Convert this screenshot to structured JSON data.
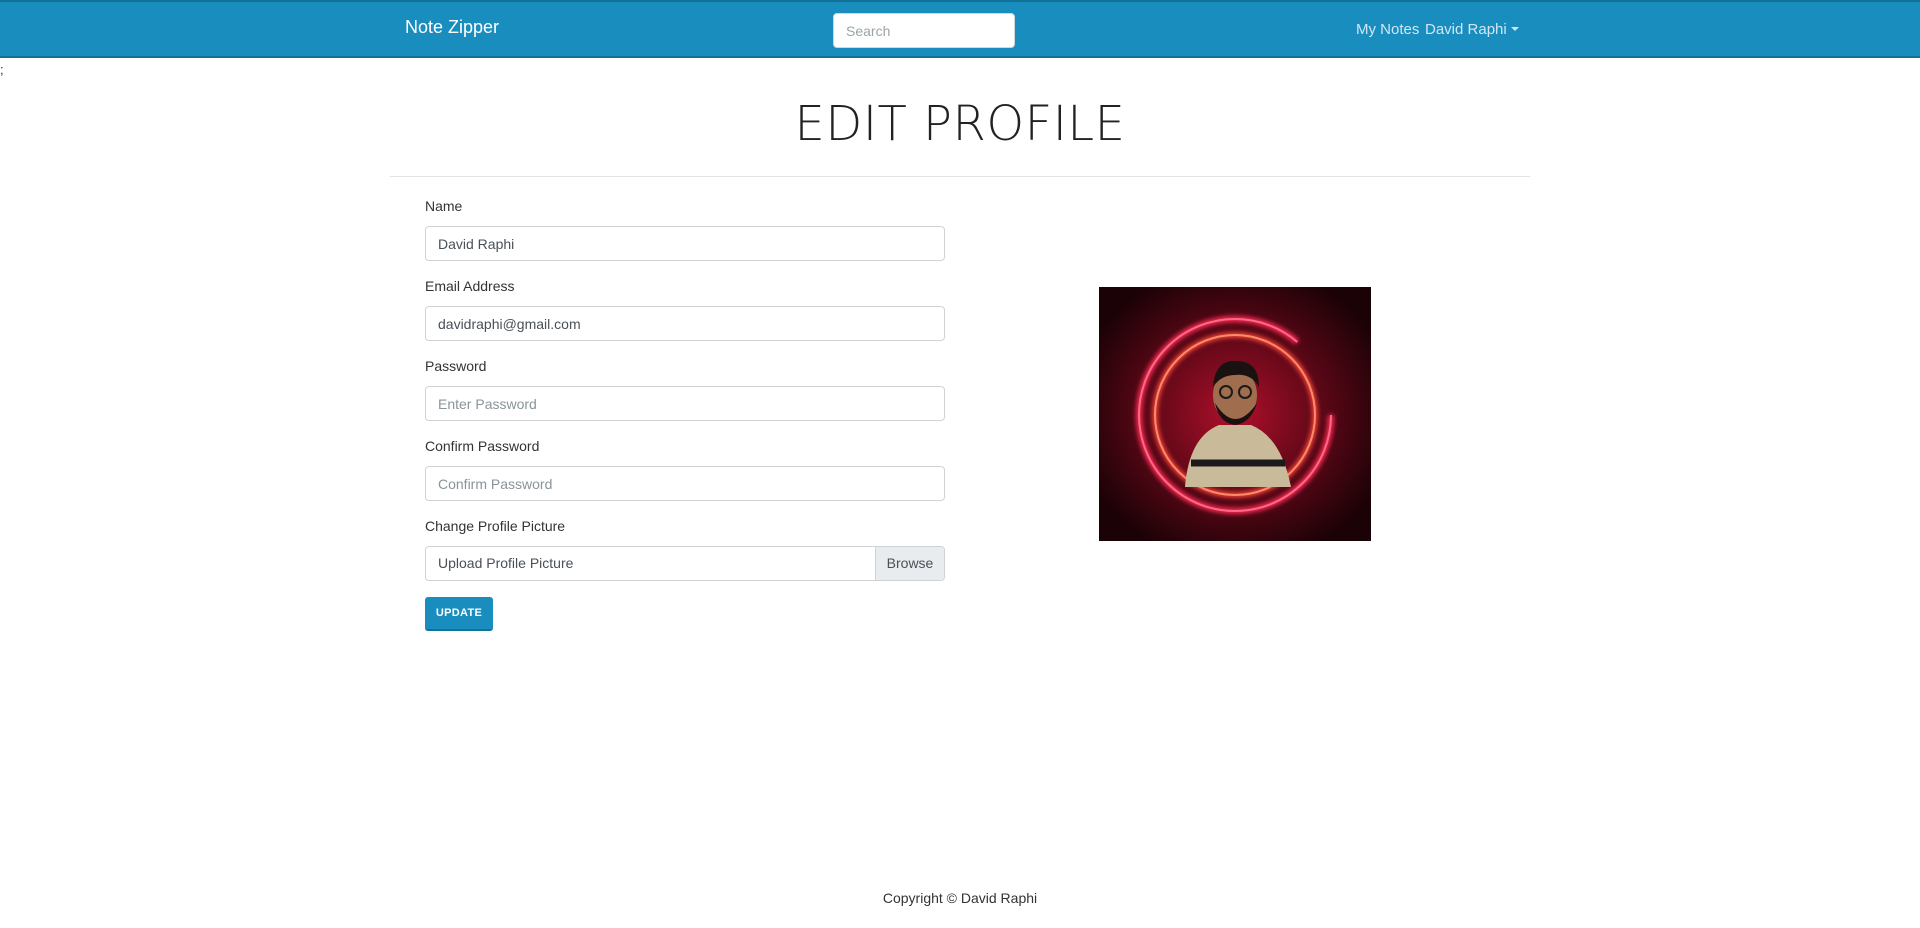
{
  "navbar": {
    "brand": "Note Zipper",
    "search_placeholder": "Search",
    "my_notes": "My Notes",
    "user_menu": "David Raphi"
  },
  "stray_text": ";",
  "page_title": "EDIT PROFILE",
  "form": {
    "name_label": "Name",
    "name_value": "David Raphi",
    "email_label": "Email Address",
    "email_value": "davidraphi@gmail.com",
    "password_label": "Password",
    "password_placeholder": "Enter Password",
    "confirm_label": "Confirm Password",
    "confirm_placeholder": "Confirm Password",
    "picture_label": "Change Profile Picture",
    "picture_placeholder": "Upload Profile Picture",
    "browse_label": "Browse",
    "update_label": "UPDATE"
  },
  "colors": {
    "brand": "#1a8dbf",
    "avatar_glow": "#ff2a55"
  },
  "footer": "Copyright © David Raphi"
}
